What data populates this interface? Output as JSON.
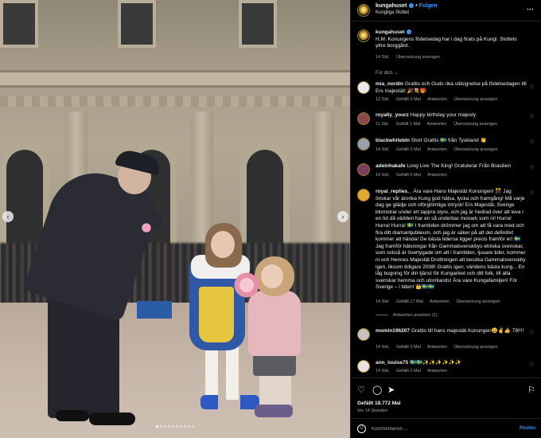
{
  "post": {
    "account": "kungahuset",
    "location": "Kungliga Slottet",
    "follow_label": "Folgen",
    "dot_separator": "•",
    "more_icon": "more-horizontal-icon"
  },
  "caption": {
    "user": "kungahuset",
    "text": "H.M. Konungens födelsedag har i dag firats på Kungl. Slottets yttre borggård.",
    "time": "14 Std.",
    "translate_label": "Übersetzung anzeigen"
  },
  "for_you_label": "Für dich ⌄",
  "comments": [
    {
      "user": "mia_nordin",
      "text": "Grattis och Guds rika välsignelse på födelsedagen till Ers majestät! 🎉💐🎁",
      "time": "12 Std.",
      "likes": "Gefällt 3 Mal",
      "reply": "Antworten",
      "translate": "Übersetzung anzeigen"
    },
    {
      "user": "royally_yourz",
      "text": "Happy birthday your majesty",
      "time": "11 Std.",
      "likes": "Gefällt 1 Mal",
      "reply": "Antworten",
      "translate": "Übersetzung anzeigen"
    },
    {
      "user": "blackwhitebln",
      "text": "Stort Grattis 🇸🇪 från Tyskland 👏",
      "time": "14 Std.",
      "likes": "Gefällt 3 Mal",
      "reply": "Antworten",
      "translate": "Übersetzung anzeigen"
    },
    {
      "user": "adeinhakafe",
      "text": "Long Live The King! Gratulerar Från Brasilien",
      "time": "14 Std.",
      "likes": "Gefällt 5 Mal",
      "reply": "Antworten",
      "translate": ""
    },
    {
      "user": "royal_replies._",
      "text": "Ära vare Hans Majestät Konungen! 🎊 Jag önskar vår ärorika Kung god hälsa, lycka och framgång! Må varje dag ge glädje och oförglömliga intryck! Ers Majestät, Sverige blomstrar under ert tappra styre, och jag är hedrad över att leva i en tid då världen har en så underbar monark som ni! Hurra! Hurra! Hurra! 🇸🇪 I framtiden drömmer jag om att få vara med och fira ditt diamantjubileum, och jag är säker på att det definitivt kommer att hända! De bästa tiderna ligger precis framför er! 🇸🇪 Jag framför hälsningar från Gammalsvenskbys etniska svenskar, som också är övertygade om att i framtiden, ljusare tider, kommer ni och Hennes Majestät Drottningen att besöka Gammalsvenskby igen, liksom tidigare 2008! Grattis igen, världens bästa kung... En låg bugning för din tjänst för Kungariket och ditt folk, till alla svenskar hemma och utomlands! Ära vare Kungafamiljen! För Sverige – i tiden! 👑🇸🇪🇸🇪",
      "time": "14 Std.",
      "likes": "Gefällt 17 Mal",
      "reply": "Antworten",
      "translate": "Übersetzung anzeigen",
      "replies": "Antworten ansehen (1)"
    },
    {
      "user": "momin196207",
      "text": "Grattis till hans majestät Konungen😀✌️👍 79!!!!",
      "time": "14 Std.",
      "likes": "Gefällt 3 Mal",
      "reply": "Antworten",
      "translate": "Übersetzung anzeigen"
    },
    {
      "user": "ann_louise75",
      "text": "🇸🇪🇸🇪✨✨✨✨✨✨",
      "time": "14 Std.",
      "likes": "Gefällt 2 Mal",
      "reply": "Antworten",
      "translate": ""
    }
  ],
  "actions": {
    "likes_label": "Gefällt 18.772 Mal",
    "posted_time": "Vor 14 Stunden",
    "comment_placeholder": "Kommentieren ...",
    "post_label": "Posten"
  },
  "carousel": {
    "prev_label": "‹",
    "next_label": "›",
    "slide_count": 10,
    "active_slide": 1
  },
  "colors": {
    "accent": "#3797f0",
    "background": "#000000",
    "muted_text": "#a8a8a8"
  }
}
